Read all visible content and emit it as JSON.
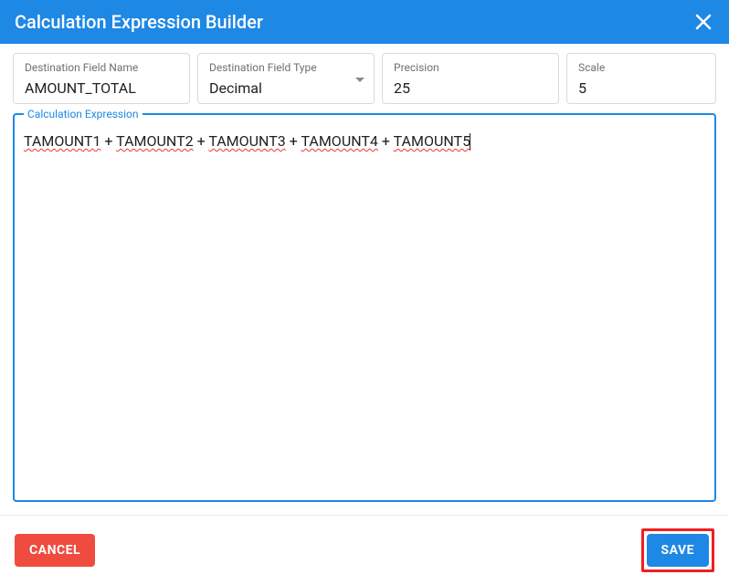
{
  "dialog": {
    "title": "Calculation Expression Builder"
  },
  "fields": {
    "destNameLabel": "Destination Field Name",
    "destNameValue": "AMOUNT_TOTAL",
    "destTypeLabel": "Destination Field Type",
    "destTypeValue": "Decimal",
    "precisionLabel": "Precision",
    "precisionValue": "25",
    "scaleLabel": "Scale",
    "scaleValue": "5"
  },
  "expression": {
    "legend": "Calculation Expression",
    "tokens": [
      "TAMOUNT1",
      "TAMOUNT2",
      "TAMOUNT3",
      "TAMOUNT4",
      "TAMOUNT5"
    ]
  },
  "buttons": {
    "cancel": "CANCEL",
    "save": "SAVE"
  },
  "colors": {
    "primary": "#1e88e5",
    "danger": "#f04b3f",
    "saveHighlight": "#f01f1f"
  }
}
